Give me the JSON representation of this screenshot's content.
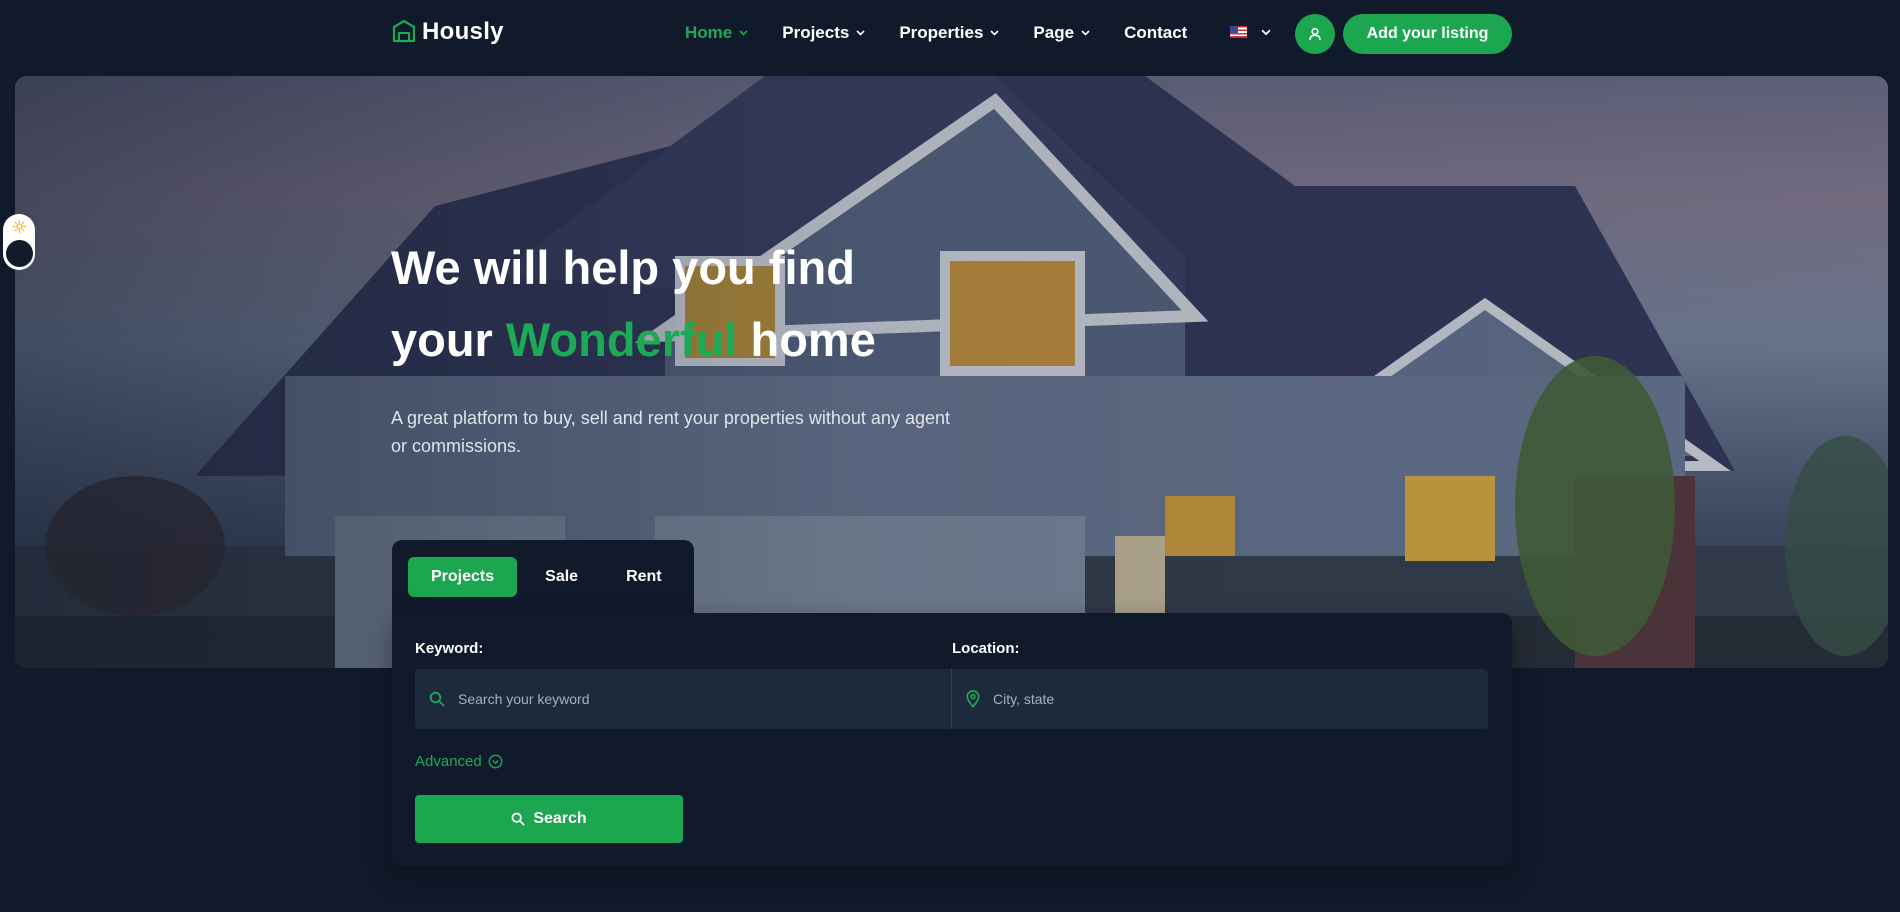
{
  "brand": {
    "name": "Hously"
  },
  "nav": {
    "items": [
      {
        "label": "Home",
        "active": true,
        "dropdown": true
      },
      {
        "label": "Projects",
        "active": false,
        "dropdown": true
      },
      {
        "label": "Properties",
        "active": false,
        "dropdown": true
      },
      {
        "label": "Page",
        "active": false,
        "dropdown": true
      },
      {
        "label": "Contact",
        "active": false,
        "dropdown": false
      }
    ],
    "language_flag": "us-flag-icon",
    "user_icon": "user-icon",
    "cta_label": "Add your listing"
  },
  "hero": {
    "title_line1": "We will help you find",
    "title_line2_prefix": "your ",
    "title_accent": "Wonderful",
    "title_line2_suffix": " home",
    "subtitle": "A great platform to buy, sell and rent your properties without any agent or commissions."
  },
  "search": {
    "tabs": [
      {
        "label": "Projects",
        "active": true
      },
      {
        "label": "Sale",
        "active": false
      },
      {
        "label": "Rent",
        "active": false
      }
    ],
    "keyword_label": "Keyword:",
    "keyword_placeholder": "Search your keyword",
    "location_label": "Location:",
    "location_placeholder": "City, state",
    "advanced_label": "Advanced",
    "button_label": "Search"
  },
  "colors": {
    "accent": "#1ba64f",
    "background": "#111a2b",
    "input_bg": "#1e293b"
  }
}
